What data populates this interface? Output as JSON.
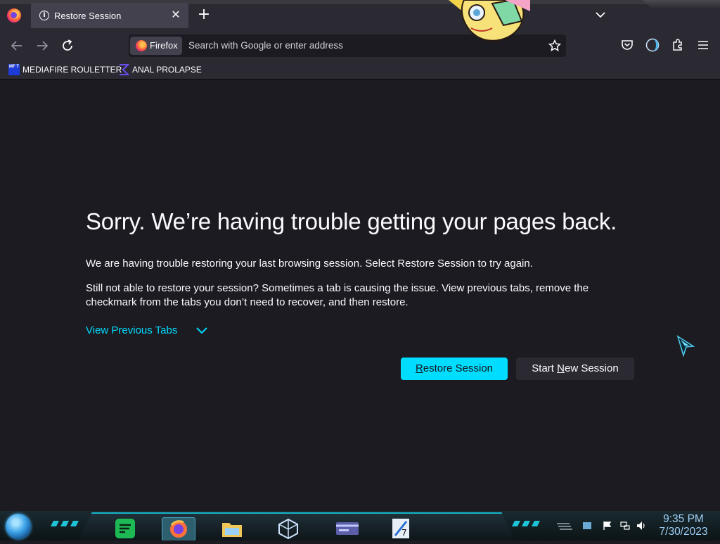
{
  "browser": {
    "tab": {
      "title": "Restore Session",
      "close": "✕"
    },
    "new_tab": "+",
    "identity_label": "Firefox",
    "url_placeholder": "Search with Google or enter address"
  },
  "bookmarks": [
    {
      "label": "MEDIAFIRE ROULETTER",
      "icon": "mediafire-icon",
      "icon_text": "MF T"
    },
    {
      "label": "ANAL PROLAPSE",
      "icon": "sigma-icon"
    }
  ],
  "page": {
    "title": "Sorry. We’re having trouble getting your pages back.",
    "para1": "We are having trouble restoring your last browsing session. Select Restore Session to try again.",
    "para2": "Still not able to restore your session? Sometimes a tab is causing the issue. View previous tabs, remove the checkmark from the tabs you don’t need to recover, and then restore.",
    "view_previous": "View Previous Tabs",
    "restore_prefix": "",
    "restore_access": "R",
    "restore_rest": "estore Session",
    "new_prefix": "Start ",
    "new_access": "N",
    "new_rest": "ew Session"
  },
  "taskbar": {
    "time": "9:35 PM",
    "date": "7/30/2023",
    "apps": [
      "spotify-icon",
      "firefox-icon",
      "file-explorer-icon",
      "virtualbox-icon",
      "control-panel-icon",
      "windows7-icon"
    ]
  },
  "colors": {
    "accent": "#00ddff",
    "background": "#1c1b22",
    "toolbar": "#2b2a33"
  }
}
